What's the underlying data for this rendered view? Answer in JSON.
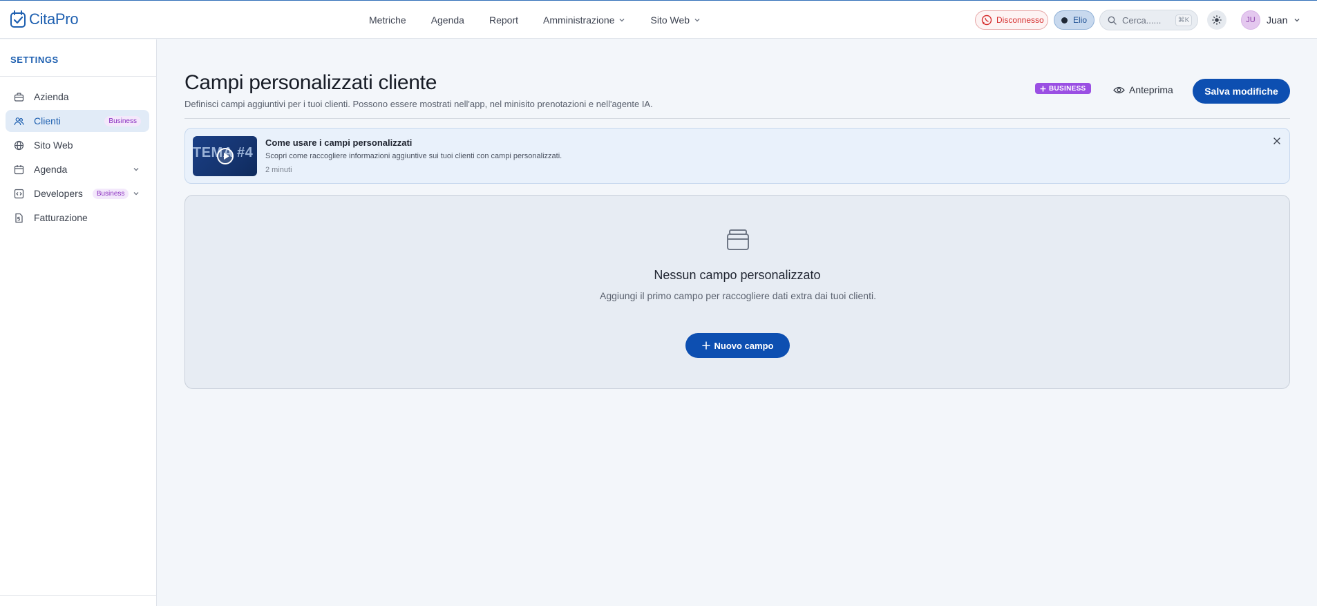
{
  "brand": {
    "logo_text": "CitaPro"
  },
  "nav": {
    "items": [
      {
        "label": "Metriche",
        "has_dropdown": false
      },
      {
        "label": "Agenda",
        "has_dropdown": false
      },
      {
        "label": "Report",
        "has_dropdown": false
      },
      {
        "label": "Amministrazione",
        "has_dropdown": true
      },
      {
        "label": "Sito Web",
        "has_dropdown": true
      }
    ]
  },
  "header": {
    "whatsapp_status": "Disconnesso",
    "agent_name": "Elio",
    "search_placeholder": "Cerca......",
    "search_shortcut": "⌘K",
    "user_initials": "JU",
    "user_name": "Juan"
  },
  "sidebar": {
    "title": "SETTINGS",
    "items": [
      {
        "label": "Azienda",
        "icon": "briefcase-icon",
        "active": false
      },
      {
        "label": "Clienti",
        "icon": "users-icon",
        "active": true,
        "badge": "Business"
      },
      {
        "label": "Sito Web",
        "icon": "globe-icon",
        "active": false
      },
      {
        "label": "Agenda",
        "icon": "calendar-icon",
        "active": false,
        "expandable": true
      },
      {
        "label": "Developers",
        "icon": "code-icon",
        "active": false,
        "badge": "Business",
        "expandable": true
      },
      {
        "label": "Fatturazione",
        "icon": "invoice-icon",
        "active": false
      }
    ]
  },
  "page": {
    "title": "Campi personalizzati cliente",
    "subtitle": "Definisci campi aggiuntivi per i tuoi clienti. Possono essere mostrati nell'app, nel minisito prenotazioni e nell'agente IA.",
    "plan_badge": "BUSINESS",
    "preview_label": "Anteprima",
    "save_label": "Salva modifiche"
  },
  "tutorial": {
    "thumbnail_text": "TEMA #4",
    "title": "Come usare i campi personalizzati",
    "description": "Scopri come raccogliere informazioni aggiuntive sui tuoi clienti con campi personalizzati.",
    "duration": "2 minuti"
  },
  "empty_state": {
    "title": "Nessun campo personalizzato",
    "description": "Aggiungi il primo campo per raccogliere dati extra dai tuoi clienti.",
    "button_label": "Nuovo campo"
  },
  "colors": {
    "primary": "#0d4fb1",
    "brand": "#1d5fb0",
    "business": "#9a4fe3",
    "danger": "#d62f2f"
  }
}
